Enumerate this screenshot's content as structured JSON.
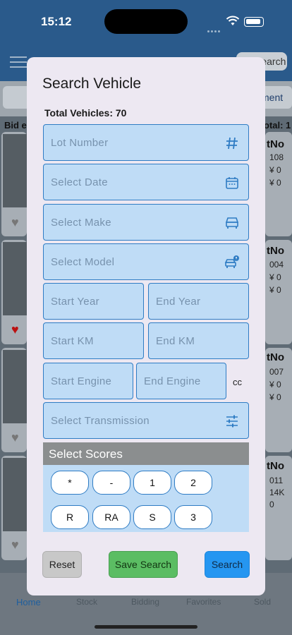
{
  "status_bar": {
    "time": "15:12"
  },
  "background": {
    "header_search_label": "Search",
    "right_strip_label": "ment",
    "bid_label": "Bid e",
    "total_label": "otal: 1",
    "cards": [
      {
        "lot_label": "tNo",
        "line1": "108",
        "line2": "¥ 0",
        "line3": "¥ 0"
      },
      {
        "lot_label": "tNo",
        "line1": "004",
        "line2": "¥ 0",
        "line3": "¥ 0"
      },
      {
        "lot_label": "tNo",
        "line1": "007",
        "line2": "¥ 0",
        "line3": "¥ 0"
      },
      {
        "lot_label": "tNo",
        "line1": "011",
        "line2": "14K",
        "line3": "0"
      }
    ],
    "tabs": [
      {
        "label": "Home"
      },
      {
        "label": "Stock"
      },
      {
        "label": "Bidding"
      },
      {
        "label": "Favorites"
      },
      {
        "label": "Sold"
      }
    ]
  },
  "modal": {
    "title": "Search Vehicle",
    "total_vehicles": "Total Vehicles: 70",
    "fields": {
      "lot_number": {
        "placeholder": "Lot Number",
        "value": ""
      },
      "date": {
        "placeholder": "Select Date",
        "value": ""
      },
      "make": {
        "placeholder": "Select Make",
        "value": ""
      },
      "model": {
        "placeholder": "Select Model",
        "value": ""
      },
      "start_year": {
        "placeholder": "Start Year",
        "value": ""
      },
      "end_year": {
        "placeholder": "End Year",
        "value": ""
      },
      "start_km": {
        "placeholder": "Start KM",
        "value": ""
      },
      "end_km": {
        "placeholder": "End KM",
        "value": ""
      },
      "start_engine": {
        "placeholder": "Start Engine",
        "value": ""
      },
      "end_engine": {
        "placeholder": "End Engine",
        "value": ""
      },
      "transmission": {
        "placeholder": "Select Transmission",
        "value": ""
      }
    },
    "engine_unit": "cc",
    "scores": {
      "heading": "Select Scores",
      "options": [
        "*",
        "-",
        "1",
        "2",
        "R",
        "RA",
        "S",
        "3"
      ]
    },
    "buttons": {
      "reset": "Reset",
      "save_search": "Save Search",
      "search": "Search"
    }
  },
  "colors": {
    "field_bg": "#bfdcf6",
    "field_border": "#2f7cc4",
    "save_green": "#5bbd63",
    "search_blue": "#2596f1",
    "reset_gray": "#c8c8c8"
  },
  "icons": {
    "lot_number": "hash-icon",
    "date": "calendar-icon",
    "make": "car-icon",
    "model": "car-info-icon",
    "transmission": "sliders-icon"
  }
}
